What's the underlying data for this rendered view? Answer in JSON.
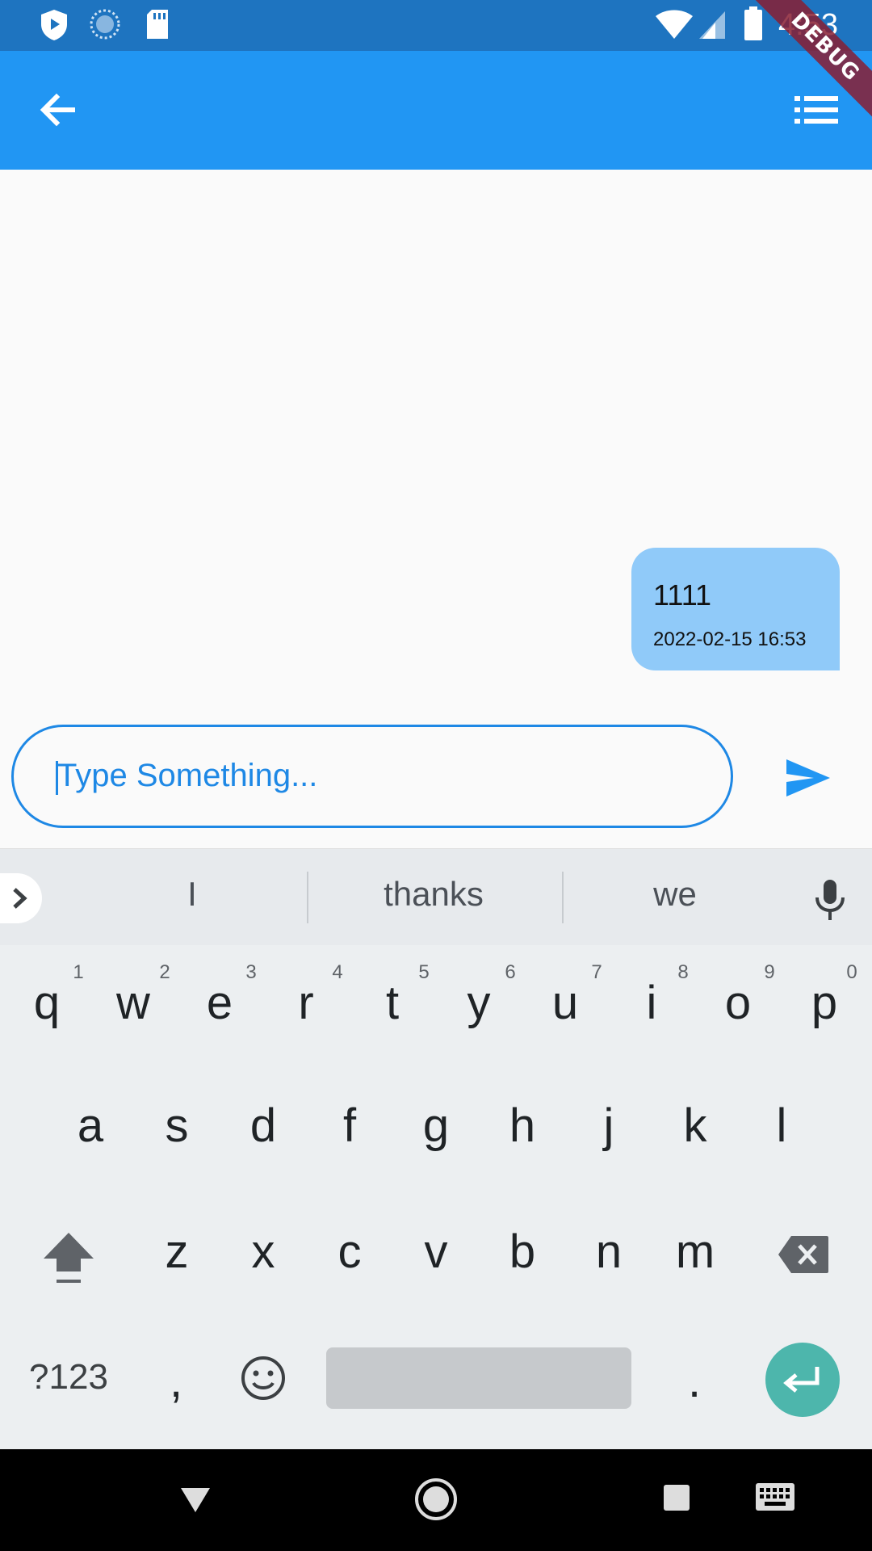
{
  "status_bar": {
    "time": "4:53"
  },
  "debug_banner": "DEBUG",
  "messages": [
    {
      "text": "1111",
      "timestamp": "2022-02-15 16:53"
    }
  ],
  "composer": {
    "placeholder": "Type Something...",
    "value": ""
  },
  "keyboard": {
    "suggestions": [
      "I",
      "thanks",
      "we"
    ],
    "row1": [
      "q",
      "w",
      "e",
      "r",
      "t",
      "y",
      "u",
      "i",
      "o",
      "p"
    ],
    "row1_hints": [
      "1",
      "2",
      "3",
      "4",
      "5",
      "6",
      "7",
      "8",
      "9",
      "0"
    ],
    "row2": [
      "a",
      "s",
      "d",
      "f",
      "g",
      "h",
      "j",
      "k",
      "l"
    ],
    "row3": [
      "z",
      "x",
      "c",
      "v",
      "b",
      "n",
      "m"
    ],
    "symbols_label": "?123",
    "comma": ",",
    "period": "."
  },
  "colors": {
    "app_bar": "#2196f3",
    "status_bar": "#1e74c0",
    "bubble": "#90caf9",
    "accent": "#1e88e5",
    "enter_key": "#4db6ac"
  }
}
